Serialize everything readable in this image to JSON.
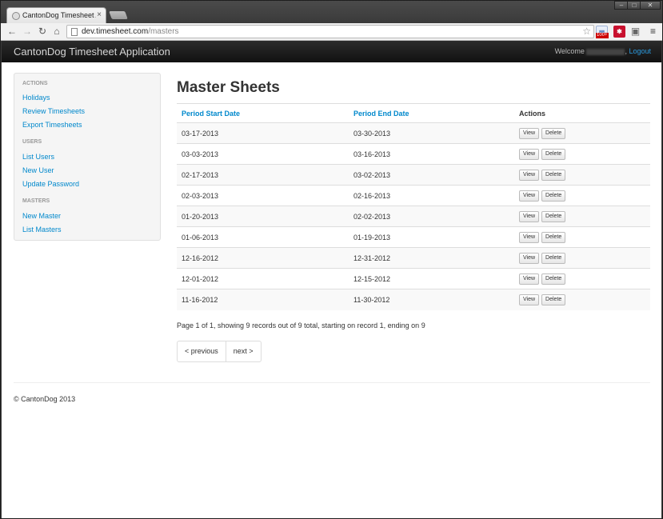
{
  "browser": {
    "tab_title": "CantonDog Timesheet Ap",
    "tab_close": "×",
    "url_host": "dev.timesheet.com",
    "url_path": "/masters",
    "ext_badge": "100+"
  },
  "app": {
    "brand": "CantonDog Timesheet Application",
    "welcome": "Welcome",
    "logout": "Logout"
  },
  "sidebar": {
    "sections": [
      {
        "header": "ACTIONS",
        "items": [
          "Holidays",
          "Review Timesheets",
          "Export Timesheets"
        ]
      },
      {
        "header": "USERS",
        "items": [
          "List Users",
          "New User",
          "Update Password"
        ]
      },
      {
        "header": "MASTERS",
        "items": [
          "New Master",
          "List Masters"
        ]
      }
    ]
  },
  "main": {
    "title": "Master Sheets",
    "columns": [
      "Period Start Date",
      "Period End Date",
      "Actions"
    ],
    "view_label": "View",
    "delete_label": "Delete",
    "rows": [
      {
        "start": "03-17-2013",
        "end": "03-30-2013"
      },
      {
        "start": "03-03-2013",
        "end": "03-16-2013"
      },
      {
        "start": "02-17-2013",
        "end": "03-02-2013"
      },
      {
        "start": "02-03-2013",
        "end": "02-16-2013"
      },
      {
        "start": "01-20-2013",
        "end": "02-02-2013"
      },
      {
        "start": "01-06-2013",
        "end": "01-19-2013"
      },
      {
        "start": "12-16-2012",
        "end": "12-31-2012"
      },
      {
        "start": "12-01-2012",
        "end": "12-15-2012"
      },
      {
        "start": "11-16-2012",
        "end": "11-30-2012"
      }
    ],
    "summary": "Page 1 of 1, showing 9 records out of 9 total, starting on record 1, ending on 9",
    "prev": "< previous",
    "next": "next >"
  },
  "footer": "© CantonDog 2013"
}
